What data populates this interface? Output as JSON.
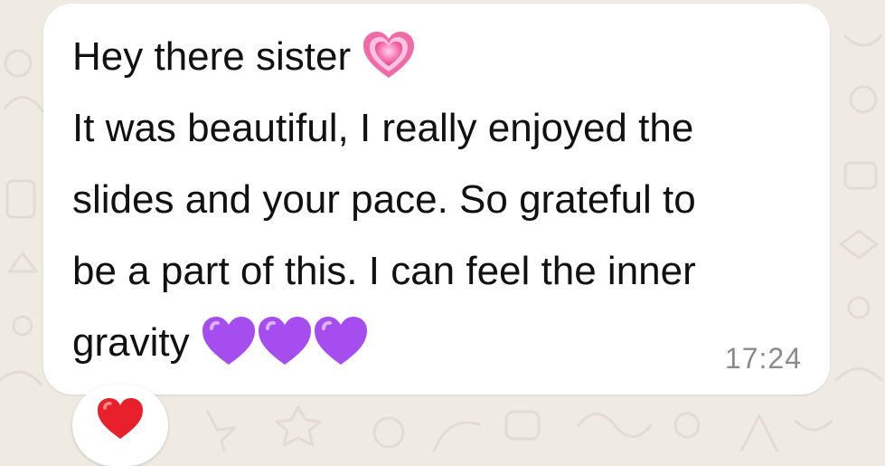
{
  "chat": {
    "message": {
      "lines": [
        "Hey there sister",
        "It was beautiful, I really enjoyed the",
        "slides and your pace. So grateful to",
        "be a part of this. I can feel the inner",
        "gravity"
      ],
      "emojis": {
        "line1": "growing-heart",
        "line5": [
          "purple-heart",
          "purple-heart",
          "purple-heart"
        ]
      },
      "timestamp": "17:24"
    },
    "reaction": {
      "emoji": "red-heart"
    }
  },
  "colors": {
    "background": "#EFEAE2",
    "bubble": "#FFFFFF",
    "text": "#111111",
    "timestamp": "#8B8B8B",
    "purple_heart": "#A64DF0",
    "red_heart": "#E8202B",
    "pink_heart": "#F0509A"
  }
}
